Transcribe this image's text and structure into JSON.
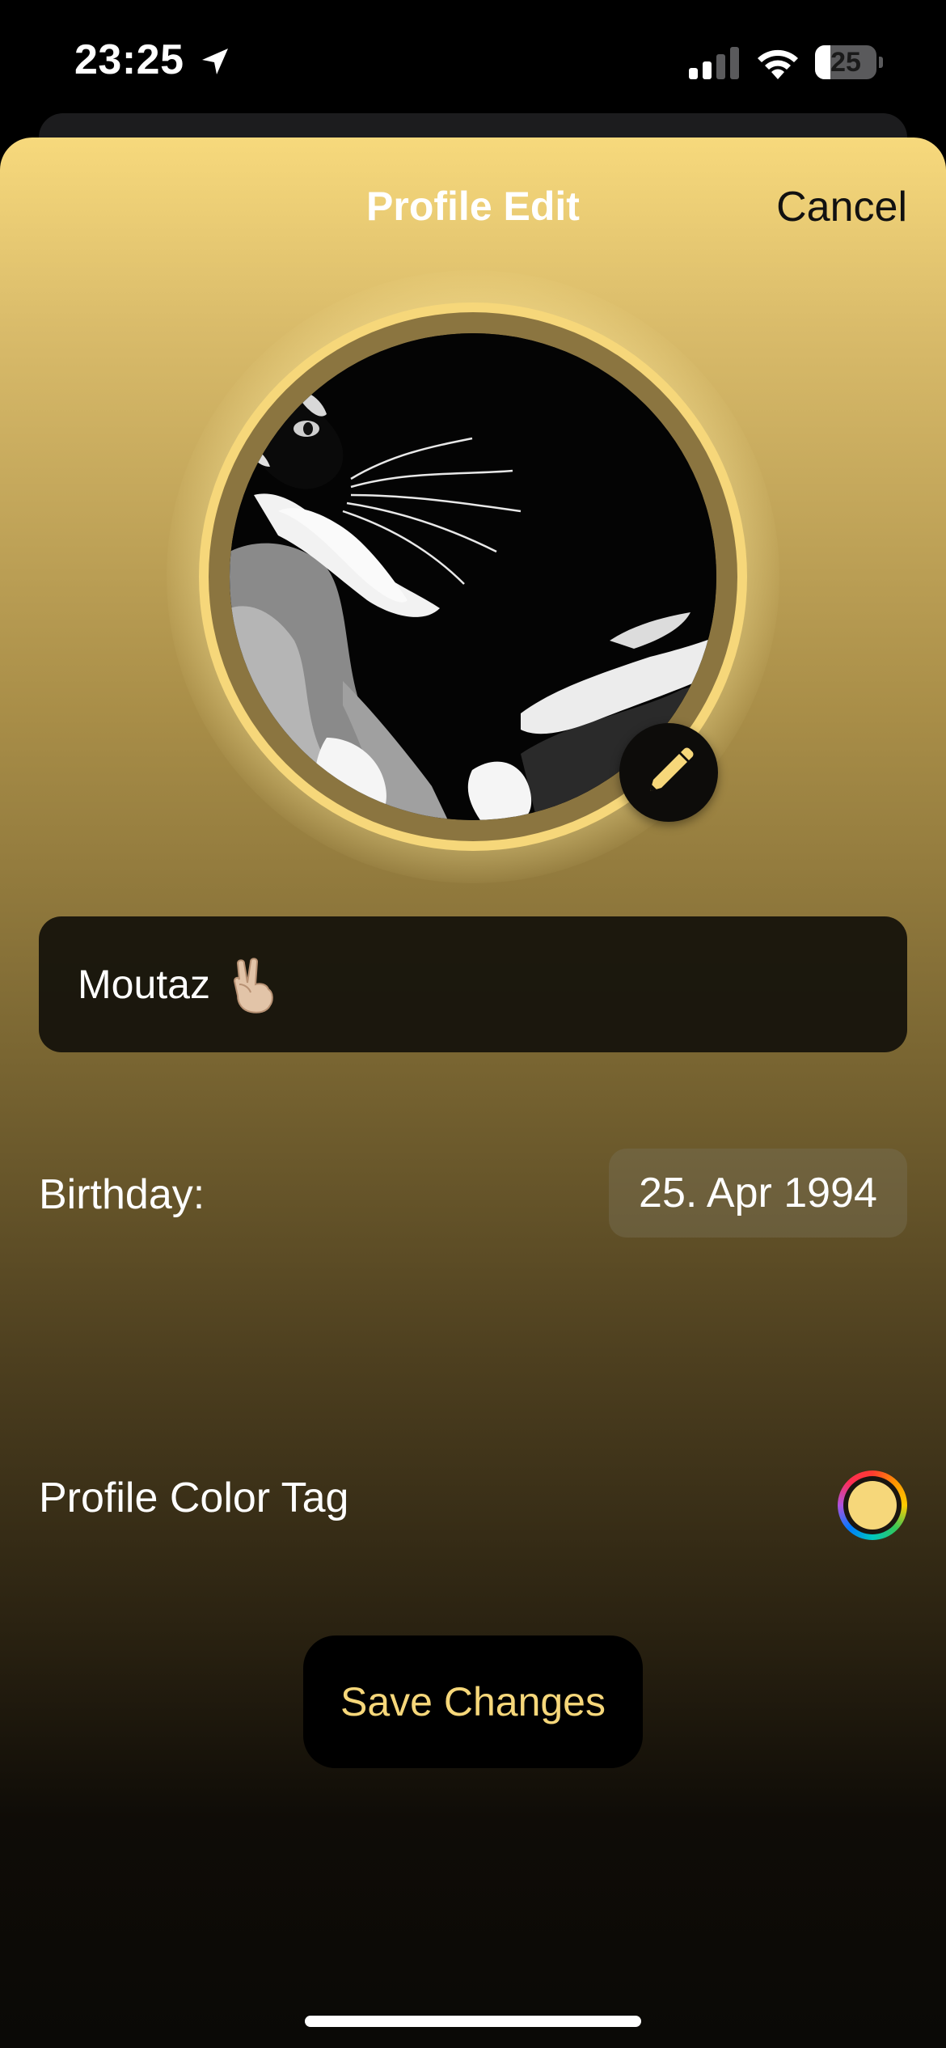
{
  "status_bar": {
    "time": "23:25",
    "battery_level": "25",
    "battery_percent": 25,
    "signal_bars_active": 2,
    "signal_bars_total": 4
  },
  "sheet": {
    "title": "Profile Edit",
    "cancel_label": "Cancel"
  },
  "profile": {
    "name": "Moutaz",
    "name_emoji": "peace-hand-emoji",
    "avatar": "cat-photo",
    "edit_icon": "pencil-icon"
  },
  "birthday": {
    "label": "Birthday:",
    "value": "25. Apr 1994"
  },
  "color_tag": {
    "label": "Profile Color Tag",
    "selected_color": "#f6d77a"
  },
  "actions": {
    "save_label": "Save Changes"
  },
  "colors": {
    "accent": "#f6d77a",
    "sheet_top": "#f7d97c",
    "sheet_bottom": "#0a0906"
  }
}
